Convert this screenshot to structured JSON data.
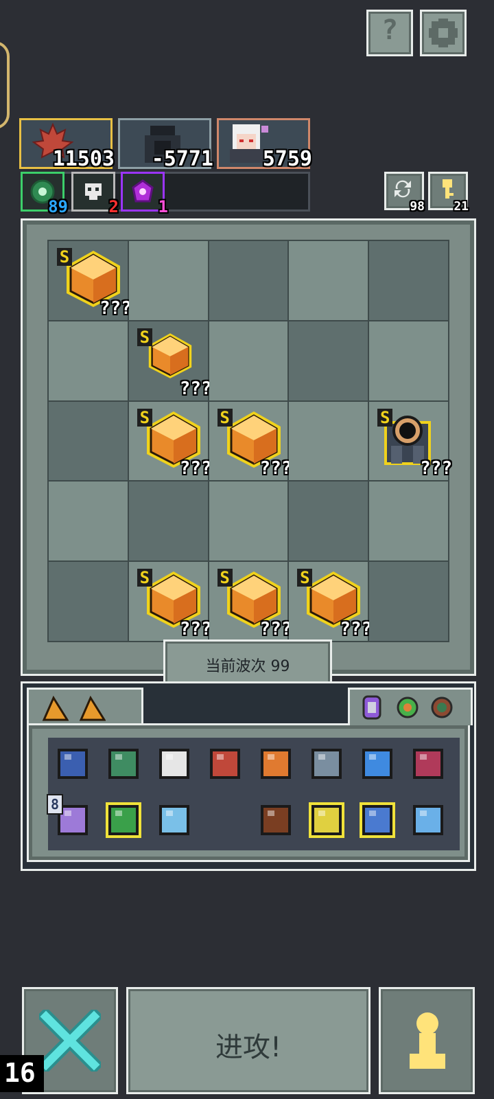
{
  "top_buttons": {
    "help_icon": "question-icon",
    "settings_icon": "gear-icon"
  },
  "party": [
    {
      "name": "maple-leaf",
      "value": "11503",
      "border": "#e8c044"
    },
    {
      "name": "dark-knight",
      "value": "-5771",
      "border": "#8ea0a6"
    },
    {
      "name": "white-hair-girl",
      "value": "5759",
      "border": "#d0876a"
    }
  ],
  "resources": [
    {
      "icon": "green-orb-icon",
      "count": "89",
      "color": "#2aa7ff",
      "border": "#3ccf6a"
    },
    {
      "icon": "white-skull-icon",
      "count": "2",
      "color": "#ff3030",
      "border": "#b8b8b8"
    },
    {
      "icon": "purple-gem-icon",
      "count": "1",
      "color": "#ff4fd8",
      "border": "#9b35ff"
    }
  ],
  "right_counters": [
    {
      "icon": "refresh-icon",
      "count": "98"
    },
    {
      "icon": "key-icon",
      "count": "21"
    }
  ],
  "board": {
    "wave_label": "当前波次 99",
    "cells": [
      {
        "row": 0,
        "col": 0,
        "item": "crystal",
        "rank": "S",
        "label": "???"
      },
      {
        "row": 1,
        "col": 1,
        "item": "small-crystal",
        "rank": "S",
        "label": "???"
      },
      {
        "row": 2,
        "col": 1,
        "item": "crystal",
        "rank": "S",
        "label": "???"
      },
      {
        "row": 2,
        "col": 2,
        "item": "crystal",
        "rank": "S",
        "label": "???"
      },
      {
        "row": 2,
        "col": 4,
        "item": "portal-monster",
        "rank": "S",
        "label": "???"
      },
      {
        "row": 4,
        "col": 1,
        "item": "crystal",
        "rank": "S",
        "label": "???"
      },
      {
        "row": 4,
        "col": 2,
        "item": "crystal",
        "rank": "S",
        "label": "???"
      },
      {
        "row": 4,
        "col": 3,
        "item": "crystal",
        "rank": "S",
        "label": "???"
      }
    ]
  },
  "inventory": {
    "tab_icons": [
      "wedge-icon",
      "wedge-icon"
    ],
    "right_icons": [
      "purple-ring-icon",
      "green-ring-icon",
      "brown-ring-icon"
    ],
    "items": [
      "armor-icon",
      "turtle-shell-icon",
      "scroll-icon",
      "maple-leaf-icon",
      "diamond-rune-icon",
      "basket-icon",
      "battery-icon",
      "dna-icon",
      "sparkle-icon",
      "green-orb-item-icon",
      "molecule-icon",
      "",
      "wood-log-icon",
      "potion-flask-icon",
      "backpack-icon",
      "blue-potion-icon"
    ],
    "sparkle_count": "8"
  },
  "bottom": {
    "cancel_icon": "cross-icon",
    "cancel_count": "16",
    "attack_label": "进攻!",
    "pawn_icon": "pawn-icon"
  }
}
